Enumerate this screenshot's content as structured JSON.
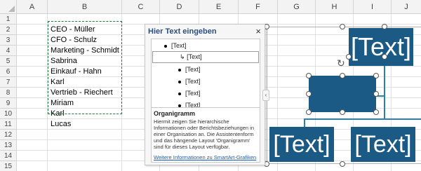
{
  "columns": [
    "A",
    "B",
    "C",
    "D",
    "E",
    "F",
    "G",
    "H",
    "I",
    "J"
  ],
  "rows": [
    "1",
    "2",
    "3",
    "4",
    "5",
    "6",
    "7",
    "8",
    "9",
    "10",
    "11",
    "12",
    "13",
    "14",
    "15",
    "16"
  ],
  "cells": [
    "CEO - Müller",
    "CFO - Schulz",
    "Marketing - Schmidt",
    "Sabrina",
    "Einkauf - Hahn",
    "Karl",
    "Vertrieb - Riechert",
    "Miriam",
    "Karl",
    "Lucas"
  ],
  "text_pane": {
    "title": "Hier Text eingeben",
    "close": "×",
    "items": [
      "[Text]",
      "[Text]",
      "[Text]",
      "[Text]",
      "[Text]",
      "[Text]"
    ],
    "sub_arrow": "↳",
    "info_title": "Organigramm",
    "info_text": "Hiermit zeigen Sie hierarchische Informationen oder Berichtsbeziehungen in einer Organisation an. Die Assistentenform und das hängende Layout 'Organigramm' sind für dieses Layout verfügbar.",
    "info_link": "Weitere Informationen zu SmartArt-Grafiken",
    "grip": "‹"
  },
  "smartart": {
    "top_box": "[Text]",
    "bottom_left_box": "[Text]",
    "bottom_right_box": "[Text]",
    "rotate_icon": "↻"
  },
  "colors": {
    "box_fill": "#1b5a84",
    "connector": "#2a7fb5",
    "copy_border": "#1f7a3e",
    "pane_title": "#2b4f7a"
  }
}
